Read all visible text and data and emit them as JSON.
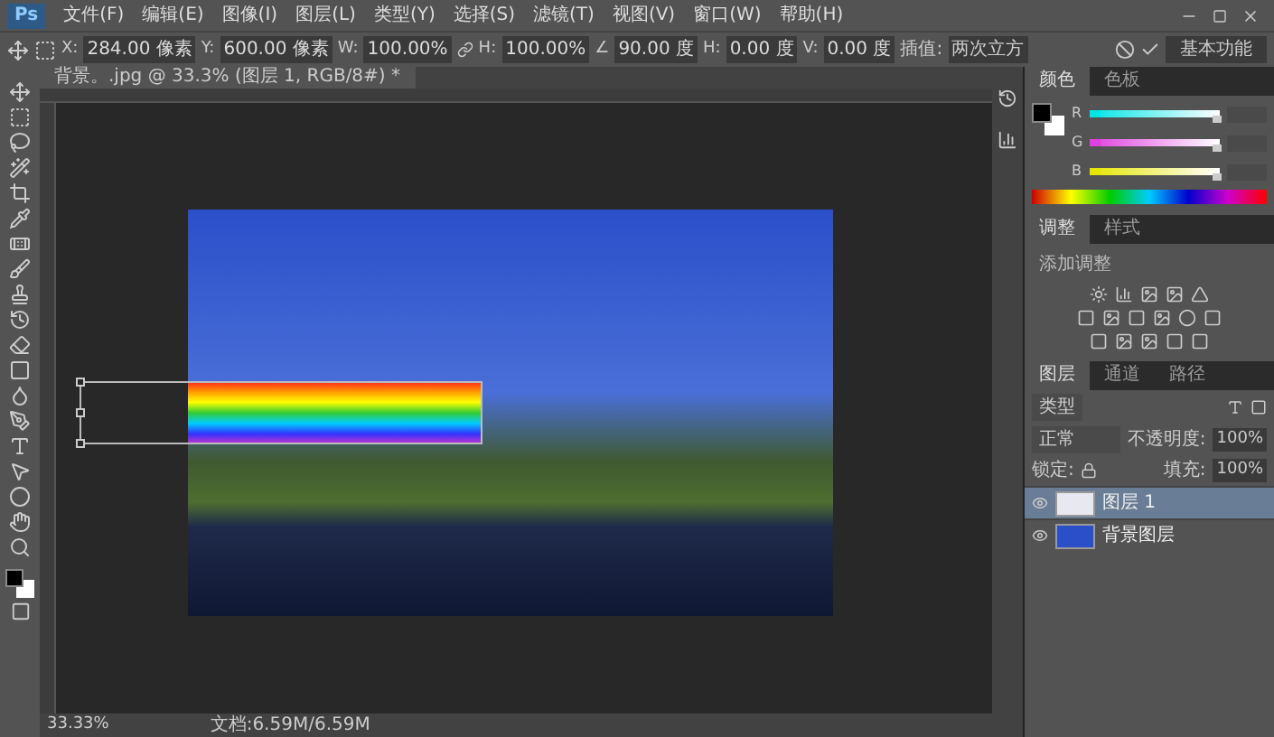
{
  "app": {
    "logo": "Ps"
  },
  "menu": [
    "文件(F)",
    "编辑(E)",
    "图像(I)",
    "图层(L)",
    "类型(Y)",
    "选择(S)",
    "滤镜(T)",
    "视图(V)",
    "窗口(W)",
    "帮助(H)"
  ],
  "options_bar": {
    "fields": [
      {
        "label": "X:",
        "value": "284.00 像素"
      },
      {
        "label": "Y:",
        "value": "600.00 像素"
      },
      {
        "label": "W:",
        "value": "100.00%"
      },
      {
        "label": "H:",
        "value": "100.00%"
      },
      {
        "label": "∠",
        "value": "90.00 度"
      },
      {
        "label": "H:",
        "value": "0.00 度"
      },
      {
        "label": "V:",
        "value": "0.00 度"
      }
    ],
    "interpolation": {
      "label": "插值:",
      "value": "两次立方"
    },
    "workspace": "基本功能"
  },
  "document_tab": {
    "title": "背景。.jpg @ 33.3% (图层 1, RGB/8#) *"
  },
  "color_panel": {
    "tabs": [
      {
        "label": "颜色",
        "selected": true
      },
      {
        "label": "色板",
        "selected": false
      }
    ],
    "sliders": [
      {
        "label": "R",
        "color": "#00e5e5",
        "level": 0.98
      },
      {
        "label": "G",
        "color": "#e040e0",
        "level": 0.98
      },
      {
        "label": "B",
        "color": "#e5e500",
        "level": 0.98
      }
    ]
  },
  "adjustments_panel": {
    "tabs": [
      {
        "label": "调整",
        "selected": true
      },
      {
        "label": "样式",
        "selected": false
      }
    ],
    "subtitle": "添加调整"
  },
  "layers_panel": {
    "tabs": [
      {
        "label": "图层",
        "selected": true
      },
      {
        "label": "通道",
        "selected": false
      },
      {
        "label": "路径",
        "selected": false
      }
    ],
    "filter": "类型",
    "blend_mode": "正常",
    "opacity": {
      "label": "不透明度:",
      "value": "100%"
    },
    "lock_label": "锁定:",
    "fill": {
      "label": "填充:",
      "value": "100%"
    },
    "layers": [
      {
        "name": "图层 1",
        "selected": true,
        "visible": true,
        "kind": "pixel"
      },
      {
        "name": "背景图层",
        "selected": false,
        "visible": true,
        "kind": "photo"
      }
    ]
  },
  "status_bar": {
    "zoom": "33.33%",
    "doc": "文档:6.59M/6.59M"
  }
}
